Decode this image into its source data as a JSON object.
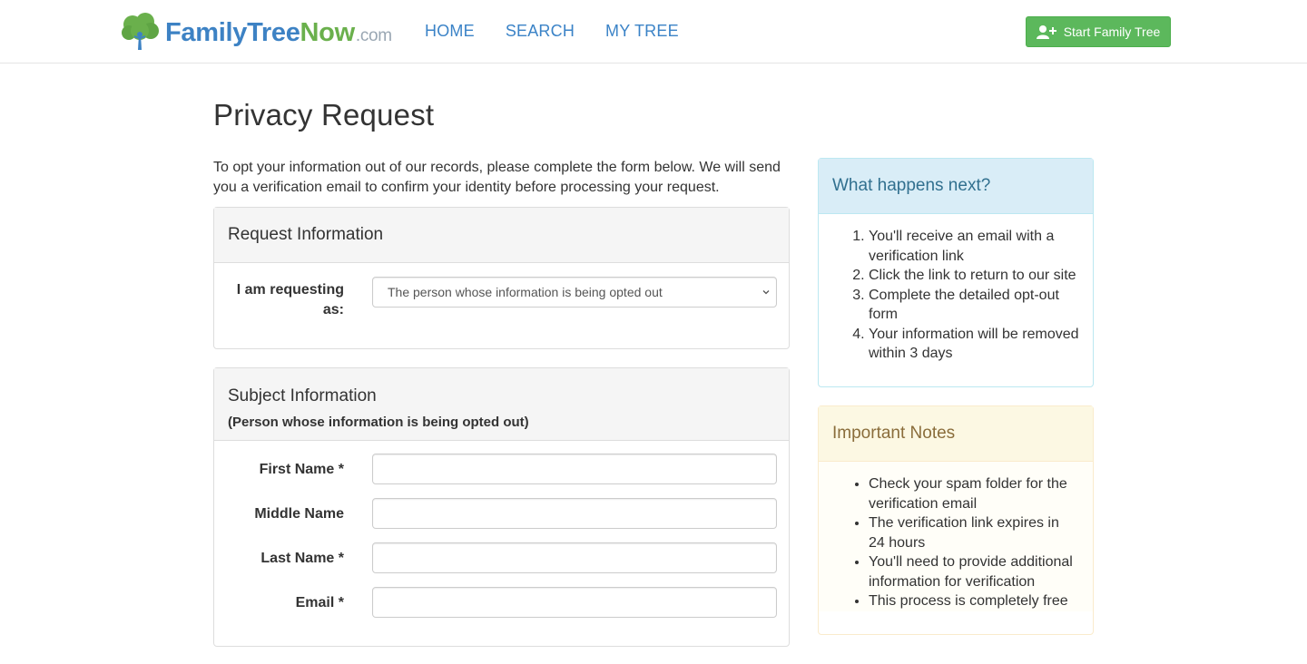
{
  "brand": {
    "part1": "FamilyTree",
    "part2": "Now",
    "part3": ".com"
  },
  "nav": {
    "home": "HOME",
    "search": "SEARCH",
    "mytree": "MY TREE"
  },
  "start_button": {
    "label": "Start Family Tree"
  },
  "page_title": "Privacy Request",
  "intro": "To opt your information out of our records, please complete the form below. We will send you a verification email to confirm your identity before processing your request.",
  "request_panel": {
    "title": "Request Information",
    "requesting_label": "I am requesting as:",
    "requesting_value": "The person whose information is being opted out"
  },
  "subject_panel": {
    "title": "Subject Information",
    "subtitle": "(Person whose information is being opted out)",
    "first_name_label": "First Name",
    "middle_name_label": "Middle Name",
    "last_name_label": "Last Name",
    "email_label": "Email",
    "required_marker": "*"
  },
  "next_panel": {
    "title": "What happens next?",
    "items": [
      "You'll receive an email with a verification link",
      "Click the link to return to our site",
      "Complete the detailed opt-out form",
      "Your information will be removed within 3 days"
    ]
  },
  "notes_panel": {
    "title": "Important Notes",
    "items": [
      "Check your spam folder for the verification email",
      "The verification link expires in 24 hours",
      "You'll need to provide additional information for verification",
      "This process is completely free"
    ]
  },
  "colors": {
    "brand_blue": "#3b83c7",
    "brand_green": "#5cb85c",
    "info_bg": "#d9edf7",
    "warning_bg": "#fcf8e3"
  },
  "icons": {
    "logo": "tree-icon",
    "start": "add-user-icon",
    "select": "chevron-down-icon"
  }
}
